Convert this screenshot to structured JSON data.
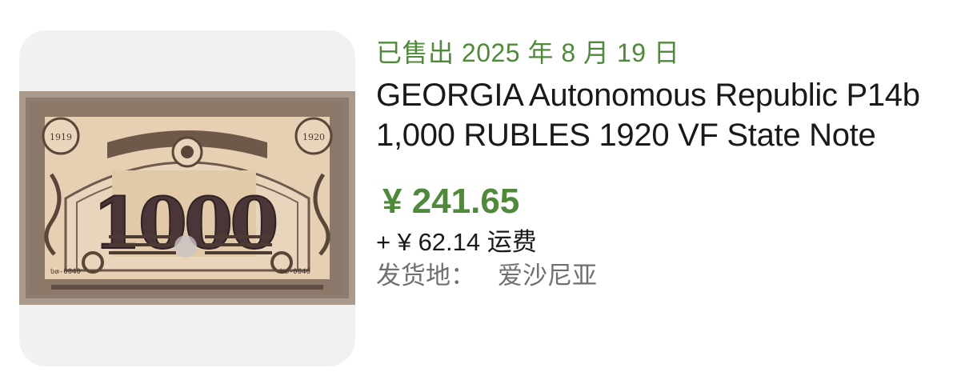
{
  "listing": {
    "sold_label": "已售出 2025 年 8 月 19 日",
    "title": "GEORGIA Autonomous Republic P14b 1,000 RUBLES 1920 VF State Note",
    "price": "¥ 241.65",
    "shipping": "+ ¥ 62.14 运费",
    "location_label": "发货地：",
    "location_value": "爱沙尼亚"
  },
  "banknote": {
    "denomination": "1000",
    "year_left": "1919",
    "year_right": "1920",
    "serial_left": "სთ-0040",
    "serial_right": "სთ-0040"
  }
}
